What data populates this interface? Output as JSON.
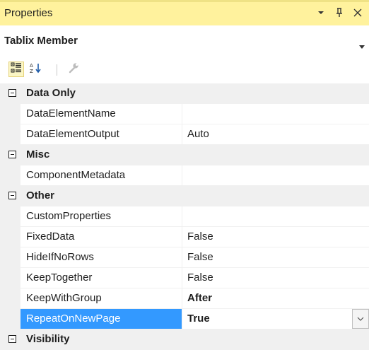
{
  "window": {
    "title": "Properties"
  },
  "object": {
    "name": "Tablix Member"
  },
  "colors": {
    "titlebar": "#fff29d",
    "selection": "#3399ff",
    "category": "#f0f0f0"
  },
  "toolbar": {
    "tools": [
      {
        "icon": "categorized-icon",
        "active": true
      },
      {
        "icon": "alphabetical-sort-icon",
        "active": false
      },
      {
        "icon": "property-pages-wrench-icon",
        "active": false
      }
    ]
  },
  "grid": {
    "categories": [
      {
        "label": "Data Only",
        "expanded": true,
        "properties": [
          {
            "name": "DataElementName",
            "value": ""
          },
          {
            "name": "DataElementOutput",
            "value": "Auto"
          }
        ]
      },
      {
        "label": "Misc",
        "expanded": true,
        "properties": [
          {
            "name": "ComponentMetadata",
            "value": ""
          }
        ]
      },
      {
        "label": "Other",
        "expanded": true,
        "properties": [
          {
            "name": "CustomProperties",
            "value": ""
          },
          {
            "name": "FixedData",
            "value": "False"
          },
          {
            "name": "HideIfNoRows",
            "value": "False"
          },
          {
            "name": "KeepTogether",
            "value": "False"
          },
          {
            "name": "KeepWithGroup",
            "value": "After",
            "bold": true
          },
          {
            "name": "RepeatOnNewPage",
            "value": "True",
            "bold": true,
            "selected": true,
            "dropdown": true
          }
        ]
      },
      {
        "label": "Visibility",
        "expanded": true,
        "properties": []
      }
    ]
  }
}
